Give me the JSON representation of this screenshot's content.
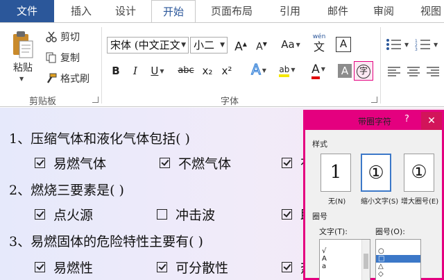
{
  "tabs": [
    {
      "label": "文件"
    },
    {
      "label": "插入"
    },
    {
      "label": "设计"
    },
    {
      "label": "开始"
    },
    {
      "label": "页面布局"
    },
    {
      "label": "引用"
    },
    {
      "label": "邮件"
    },
    {
      "label": "审阅"
    },
    {
      "label": "视图"
    }
  ],
  "ribbon": {
    "clipboard": {
      "paste": "粘贴",
      "cut": "剪切",
      "copy": "复制",
      "format_painter": "格式刷",
      "group": "剪贴板"
    },
    "font": {
      "name": "宋体 (中文正文",
      "size": "小二",
      "group": "字体",
      "wen": "wén",
      "wen_char": "文",
      "box_a": "A",
      "grow": "A",
      "shrink": "A",
      "case": "Aa",
      "bold": "B",
      "italic": "I",
      "underline": "U",
      "strike": "abc",
      "sub": "x₂",
      "sup": "x²",
      "effects": "A",
      "highlight": "ab",
      "color": "A",
      "shade": "A",
      "enclose": "字"
    }
  },
  "document": {
    "questions": [
      {
        "text": "1、压缩气体和液化气体包括( )",
        "options": [
          {
            "label": "易燃气体",
            "checked": true
          },
          {
            "label": "不燃气体",
            "checked": true
          },
          {
            "label": "有",
            "checked": true
          }
        ]
      },
      {
        "text": "2、燃烧三要素是( )",
        "options": [
          {
            "label": "点火源",
            "checked": true
          },
          {
            "label": "冲击波",
            "checked": false
          },
          {
            "label": "助",
            "checked": true
          }
        ]
      },
      {
        "text": "3、易燃固体的危险特性主要有( )",
        "options": [
          {
            "label": "易燃性",
            "checked": true
          },
          {
            "label": "可分散性",
            "checked": true
          },
          {
            "label": "热",
            "checked": true
          }
        ]
      }
    ]
  },
  "dialog": {
    "title": "带圈字符",
    "help": "?",
    "close": "✕",
    "style_label": "样式",
    "styles": [
      {
        "glyph": "1",
        "caption": "无(N)"
      },
      {
        "glyph": "①",
        "caption": "缩小文字(S)"
      },
      {
        "glyph": "①",
        "caption": "增大圈号(E)"
      }
    ],
    "ring_label": "圈号",
    "text_label": "文字(T):",
    "ring_list_label": "圈号(O):",
    "text_items": [
      "",
      "√",
      "A",
      "a"
    ],
    "ring_items": [
      "",
      "○",
      "□",
      "△",
      "◇"
    ]
  }
}
